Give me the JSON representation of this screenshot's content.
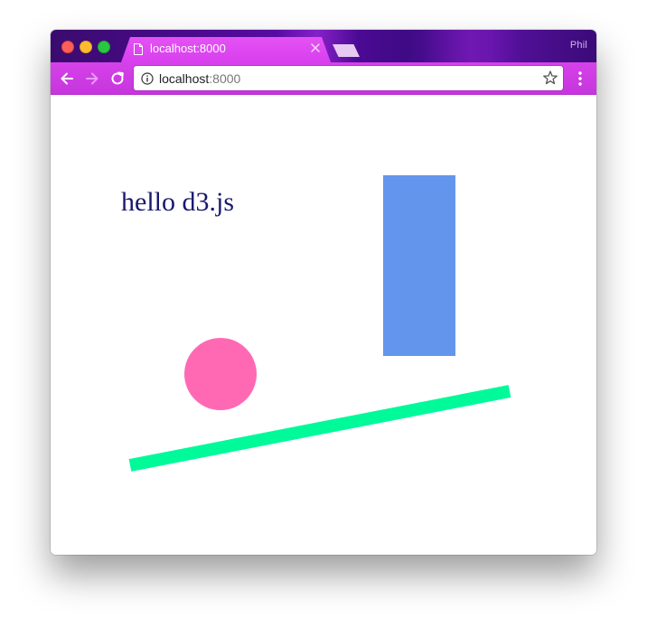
{
  "browser": {
    "profile_name": "Phil",
    "tab": {
      "title": "localhost:8000",
      "icon": "page-icon",
      "close_icon": "close-icon"
    },
    "new_tab_icon": "new-tab-icon",
    "toolbar": {
      "back_icon": "back-arrow-icon",
      "forward_icon": "forward-arrow-icon",
      "reload_icon": "reload-icon",
      "info_icon": "info-icon",
      "bookmark_icon": "star-icon",
      "menu_icon": "kebab-menu-icon"
    },
    "address_bar": {
      "host": "localhost",
      "port": ":8000"
    },
    "theme_color": "#d23ee8"
  },
  "page": {
    "heading": "hello d3.js",
    "heading_color": "#191970",
    "shapes": {
      "rect_color": "#6495ed",
      "circle_color": "#ff69b4",
      "line_color": "#00fa9a"
    }
  }
}
